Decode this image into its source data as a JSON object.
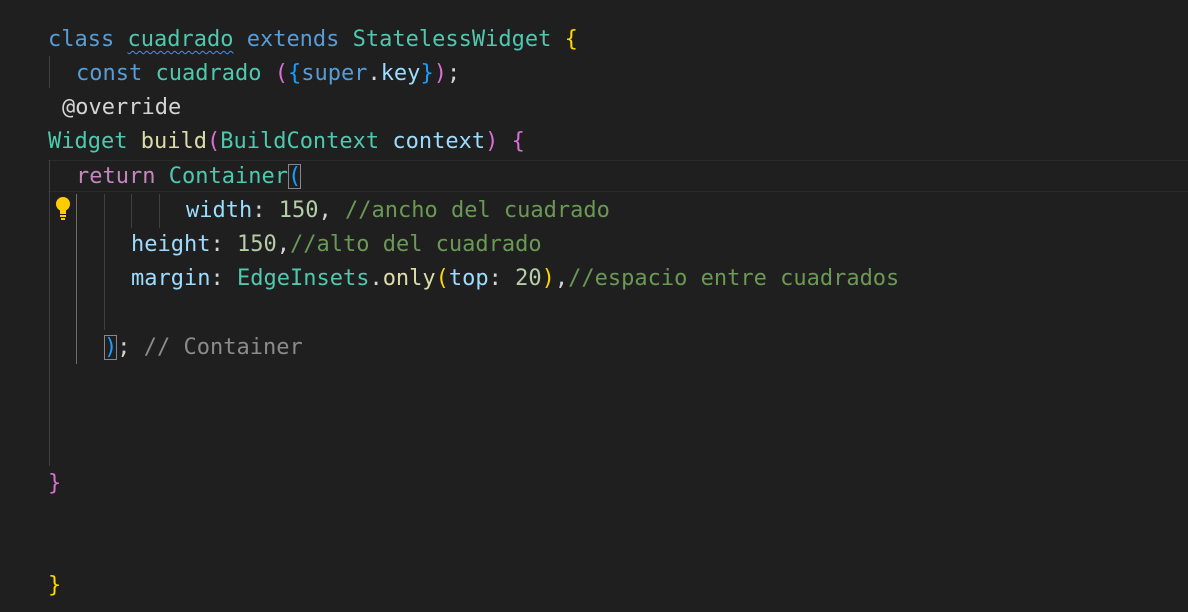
{
  "code": {
    "line1": {
      "class_kw": "class",
      "class_name": "cuadrado",
      "extends_kw": "extends",
      "parent": "StatelessWidget",
      "open_brace": "{"
    },
    "line2": {
      "const_kw": "const",
      "ctor_name": "cuadrado",
      "open": "(",
      "brace_open": "{",
      "super_kw": "super",
      "dot": ".",
      "key": "key",
      "brace_close": "}",
      "close": ")",
      "semicolon": ";"
    },
    "line3": {
      "annotation": "@override"
    },
    "line4": {
      "return_type": "Widget",
      "method": "build",
      "open": "(",
      "param_type": "BuildContext",
      "param_name": "context",
      "close": ")",
      "brace": "{"
    },
    "line5": {
      "return_kw": "return",
      "widget": "Container",
      "open": "("
    },
    "line6": {
      "prop": "width",
      "colon": ":",
      "value": "150",
      "comma": ",",
      "comment": "//ancho del cuadrado"
    },
    "line7": {
      "prop": "height",
      "colon": ":",
      "value": "150",
      "comma": ",",
      "comment": "//alto del cuadrado"
    },
    "line8": {
      "prop": "margin",
      "colon": ":",
      "class": "EdgeInsets",
      "dot": ".",
      "method": "only",
      "open": "(",
      "arg": "top",
      "arg_colon": ":",
      "value": "20",
      "close": ")",
      "comma": ",",
      "comment": "//espacio entre cuadrados"
    },
    "line10": {
      "close": ")",
      "semicolon": ";",
      "hint": "// Container"
    },
    "line14": {
      "close_brace": "}"
    },
    "line17": {
      "close_brace": "}"
    }
  },
  "colors": {
    "background": "#1f1f1f",
    "keyword": "#569cd6",
    "type": "#4ec9b0",
    "function": "#dcdcaa",
    "variable": "#9cdcfe",
    "number": "#b5cea8",
    "comment": "#6a9955",
    "control": "#c586c0",
    "bracket_gold": "#ffd700",
    "bracket_orchid": "#da70d6",
    "bracket_blue": "#179fff",
    "lightbulb": "#ffcc00"
  },
  "icons": {
    "lightbulb": "lightbulb-icon"
  }
}
